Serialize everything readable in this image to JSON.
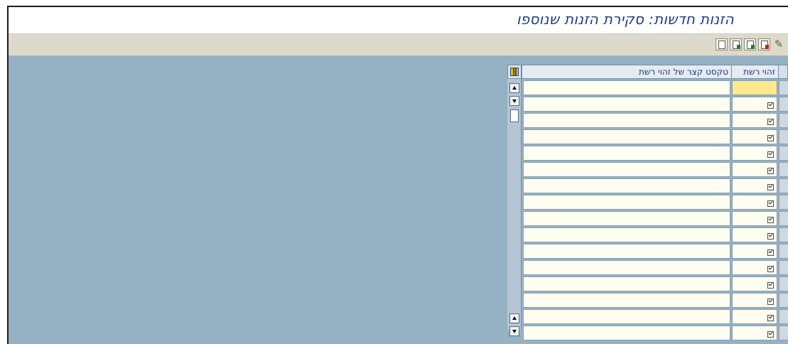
{
  "window": {
    "title": "הזנות חדשות: סקירת הזנות שנוספו"
  },
  "toolbar": {
    "buttons": [
      {
        "icon": "details-icon"
      },
      {
        "icon": "select-all-icon"
      },
      {
        "icon": "select-block-icon"
      },
      {
        "icon": "deselect-all-icon"
      },
      {
        "icon": "edit-pen-icon"
      }
    ]
  },
  "table": {
    "columns": {
      "network_id": "זהוי רשת",
      "short_text": "טקסט קצר של זהוי רשת"
    },
    "rows": [
      {
        "checked": false
      },
      {
        "checked": true
      },
      {
        "checked": true
      },
      {
        "checked": true
      },
      {
        "checked": true
      },
      {
        "checked": true
      },
      {
        "checked": true
      },
      {
        "checked": true
      },
      {
        "checked": true
      },
      {
        "checked": true
      },
      {
        "checked": true
      },
      {
        "checked": true
      },
      {
        "checked": true
      },
      {
        "checked": true
      },
      {
        "checked": true
      },
      {
        "checked": true
      }
    ]
  },
  "colors": {
    "workarea": "#95b1c4",
    "toolbar": "#dedacb",
    "title_text": "#1c3c8c",
    "cell_bg": "#fffdf0",
    "selected_cell": "#ffe98c"
  }
}
